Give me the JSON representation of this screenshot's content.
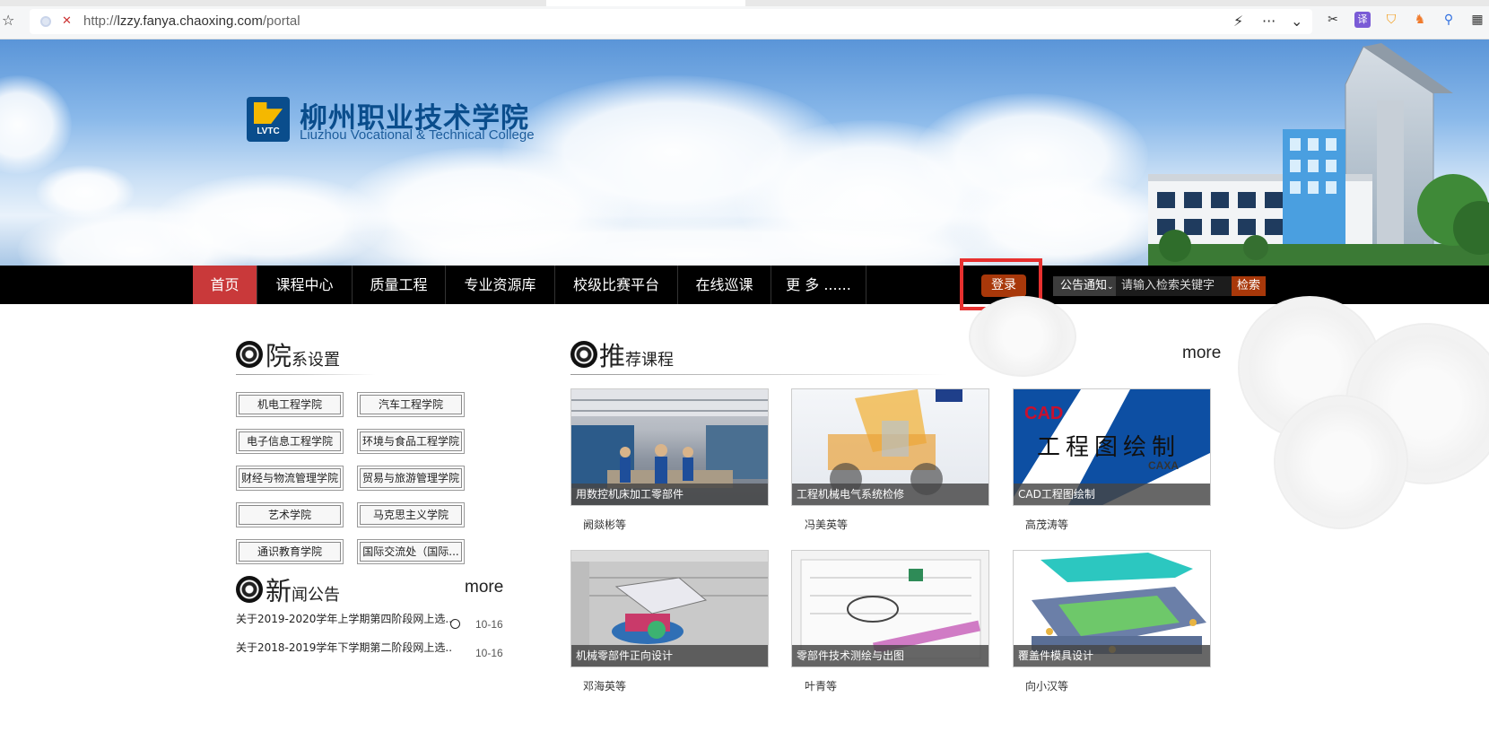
{
  "browser": {
    "url_prefix": "http://",
    "url_host": "lzzy.fanya.chaoxing.com",
    "url_path": "/portal"
  },
  "banner": {
    "school_name_cn": "柳州职业技术学院",
    "school_name_en": "Liuzhou Vocational & Technical College",
    "logo_text": "LVTC"
  },
  "nav": {
    "items": [
      "首页",
      "课程中心",
      "质量工程",
      "专业资源库",
      "校级比赛平台",
      "在线巡课",
      "更 多 ......"
    ],
    "login": "登录",
    "search_type": "公告通知",
    "search_placeholder": "请输入检索关键字",
    "search_button": "检索"
  },
  "departments": {
    "title_big": "院",
    "title_rest": "系设置",
    "items": [
      "机电工程学院",
      "汽车工程学院",
      "电子信息工程学院",
      "环境与食品工程学院",
      "财经与物流管理学院",
      "贸易与旅游管理学院",
      "艺术学院",
      "马克思主义学院",
      "通识教育学院",
      "国际交流处（国际..."
    ]
  },
  "news": {
    "title_big": "新",
    "title_rest": "闻公告",
    "more": "more",
    "items": [
      {
        "title": "关于2019-2020学年上学期第四阶段网上选...",
        "date": "10-16"
      },
      {
        "title": "关于2018-2019学年下学期第二阶段网上选...",
        "date": "10-16"
      }
    ]
  },
  "courses": {
    "title_big": "推",
    "title_rest": "荐课程",
    "more": "more",
    "items": [
      {
        "name": "用数控机床加工零部件",
        "teacher": "阙燚彬等"
      },
      {
        "name": "工程机械电气系统检修",
        "teacher": "冯美英等"
      },
      {
        "name": "CAD工程图绘制",
        "teacher": "高茂涛等"
      },
      {
        "name": "机械零部件正向设计",
        "teacher": "邓海英等"
      },
      {
        "name": "零部件技术测绘与出图",
        "teacher": "叶青等"
      },
      {
        "name": "覆盖件模具设计",
        "teacher": "向小汉等"
      }
    ],
    "cad_banner": {
      "title_small": "CAD",
      "title_big": "工程图绘制",
      "logo": "CAXA"
    }
  }
}
